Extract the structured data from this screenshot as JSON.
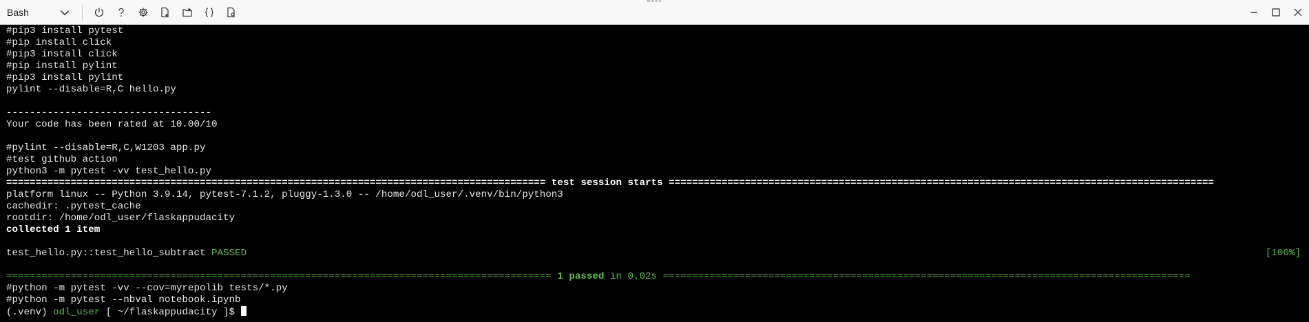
{
  "toolbar": {
    "shell_label": "Bash",
    "icons": [
      "power-icon",
      "help-icon",
      "gear-icon",
      "upload-file-icon",
      "download-file-icon",
      "braces-icon",
      "preview-icon"
    ]
  },
  "window_controls": [
    "minimize-icon",
    "maximize-icon",
    "close-icon"
  ],
  "terminal": {
    "lines": [
      "#pip3 install pytest",
      "#pip install click",
      "#pip3 install click",
      "#pip install pylint",
      "#pip3 install pylint",
      "pylint --disable=R,C hello.py",
      "",
      "-----------------------------------",
      "Your code has been rated at 10.00/10",
      "",
      "#pylint --disable=R,C,W1203 app.py",
      "#test github action",
      "python3 -m pytest -vv test_hello.py"
    ],
    "session_header_left": "============================================================================================",
    "session_header_text": " test session starts ",
    "session_header_right": "=============================================================================================",
    "platform_lines": [
      "platform linux -- Python 3.9.14, pytest-7.1.2, pluggy-1.3.0 -- /home/odl_user/.venv/bin/python3",
      "cachedir: .pytest_cache",
      "rootdir: /home/odl_user/flaskappudacity"
    ],
    "collected": "collected 1 item",
    "test_name": "test_hello.py::test_hello_subtract ",
    "test_status": "PASSED",
    "test_percent": "[100%]",
    "summary_left": "=============================================================================================",
    "summary_passed": " 1 passed",
    "summary_time": " in 0.02s ",
    "summary_right": "==========================================================================================",
    "after_lines": [
      "#python -m pytest -vv --cov=myrepolib tests/*.py",
      "#python -m pytest --nbval notebook.ipynb"
    ],
    "prompt_venv": "(.venv) ",
    "prompt_user": "odl_user",
    "prompt_path": " [ ~/flaskappudacity ]$ "
  },
  "colors": {
    "terminal_bg": "#000000",
    "terminal_fg": "#e6e6e6",
    "pass_green": "#5fb84f",
    "toolbar_bg": "#f8f8f8"
  }
}
